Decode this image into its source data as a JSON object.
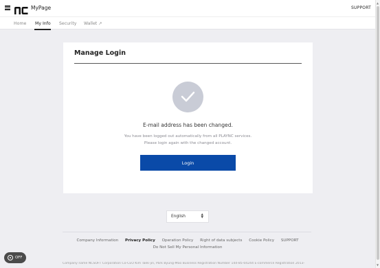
{
  "header": {
    "brand": "MyPage",
    "logo_text": "NC",
    "support": "SUPPORT"
  },
  "tabs": [
    {
      "label": "Home",
      "active": false
    },
    {
      "label": "My Info",
      "active": true
    },
    {
      "label": "Security",
      "active": false
    },
    {
      "label": "Wallet ↗",
      "active": false
    }
  ],
  "card": {
    "title": "Manage Login",
    "message": "E-mail address has been changed.",
    "sub1": "You have been logged out automatically from all PLAYNC services.",
    "sub2": "Please login again with the changed account.",
    "login_button": "Login"
  },
  "language": {
    "selected": "English"
  },
  "footer": {
    "links": [
      "Company Information",
      "Privacy Policy",
      "Operation Policy",
      "Right of data subjects",
      "Cookie Policy",
      "SUPPORT"
    ],
    "sub_link": "Do Not Sell My Personal Information",
    "company_info": "Company name NCSOFT Corporation Co-CEO Kim Taek-jin, Park Byung-Moo Business Registration Number 144-85-04244 E-commerce Registration 2013-"
  },
  "toggle": {
    "label": "OFF"
  },
  "colors": {
    "primary": "#0a4aa8",
    "background": "#eeeef2",
    "check_circle": "#c9ccd6"
  }
}
